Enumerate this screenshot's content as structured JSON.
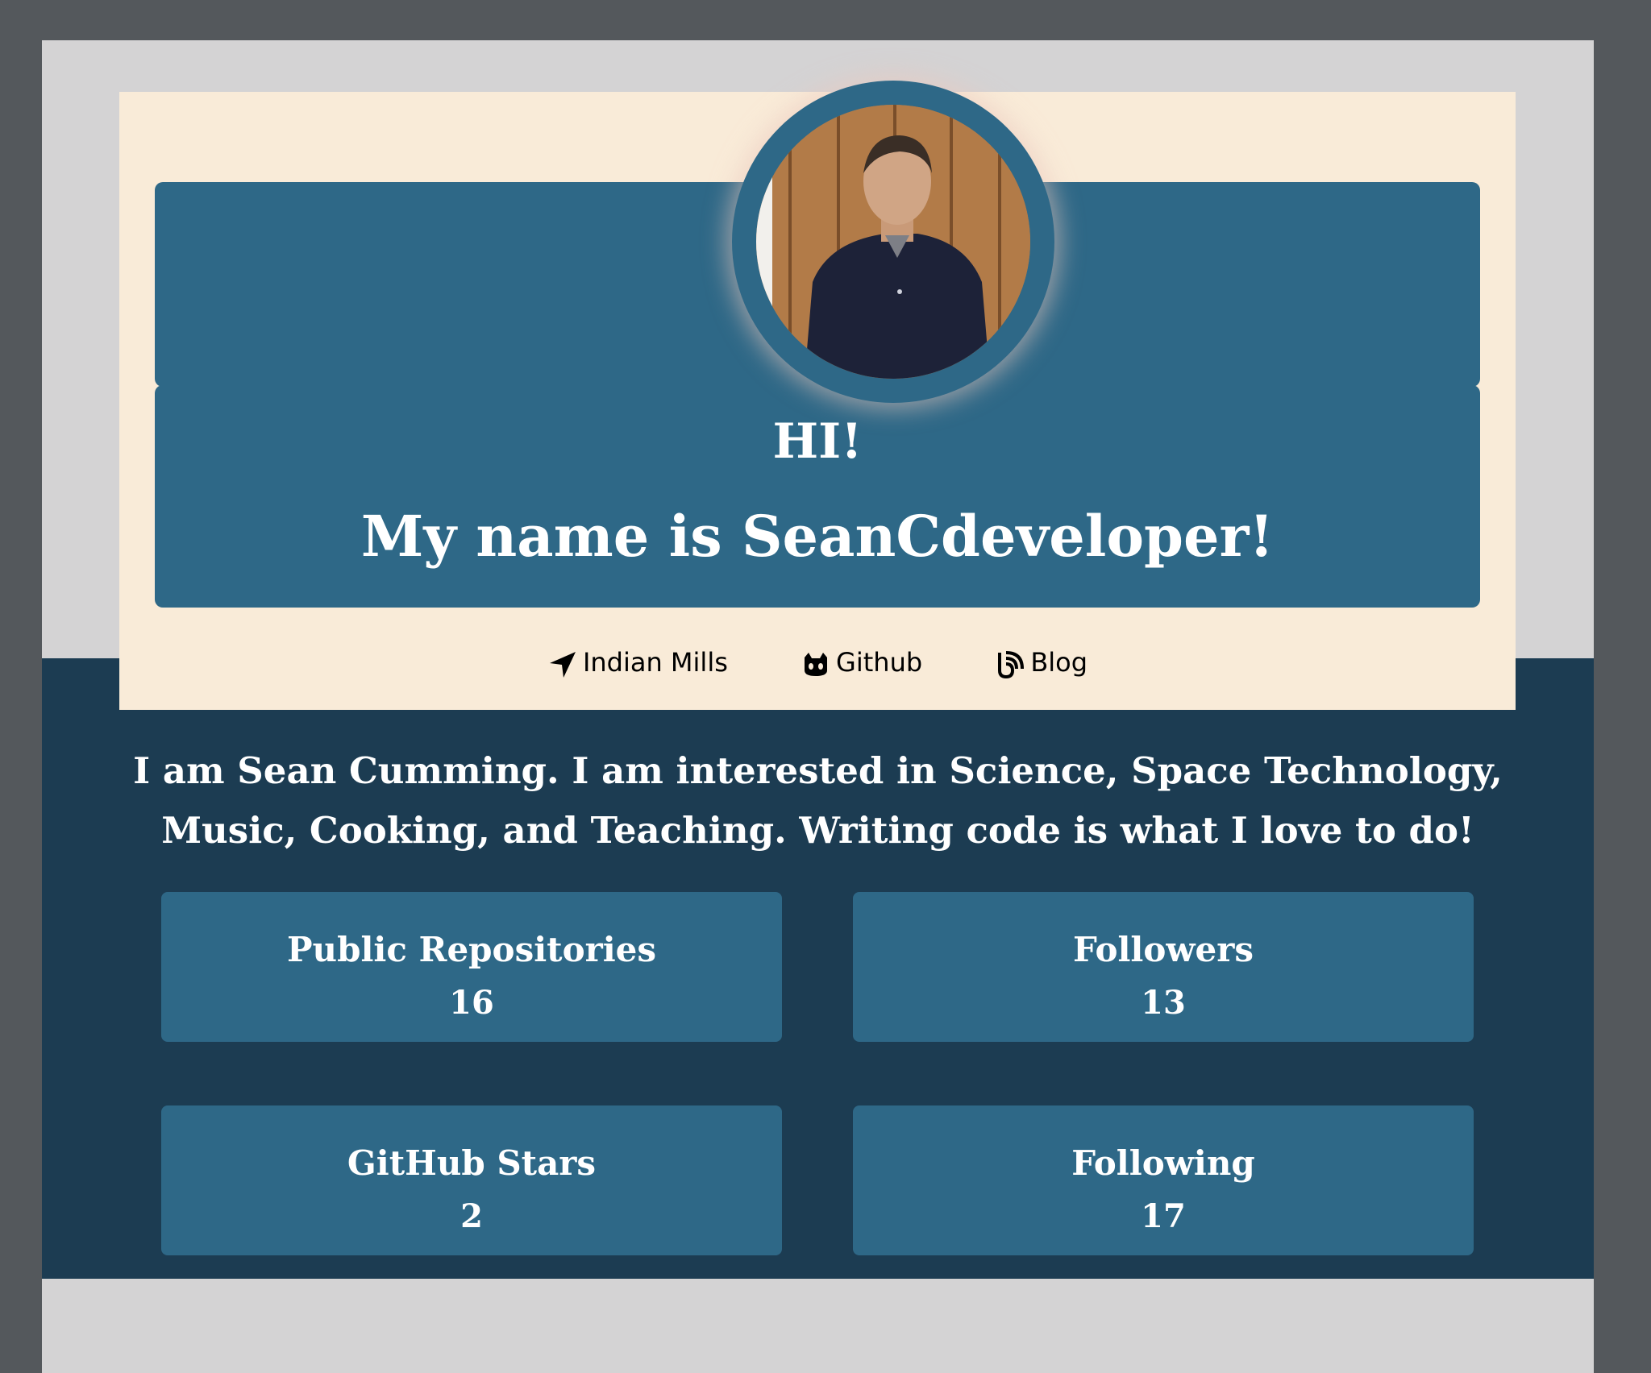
{
  "hero": {
    "greeting": "HI!",
    "name_line": "My name is SeanCdeveloper!"
  },
  "links": [
    {
      "label": "Indian Mills",
      "icon": "location-arrow-icon"
    },
    {
      "label": "Github",
      "icon": "github-icon"
    },
    {
      "label": "Blog",
      "icon": "rss-icon"
    }
  ],
  "bio": "I am Sean Cumming. I am interested in Science, Space Technology, Music, Cooking, and Teaching. Writing code is what I love to do!",
  "stats": [
    {
      "label": "Public Repositories",
      "value": "16"
    },
    {
      "label": "Followers",
      "value": "13"
    },
    {
      "label": "GitHub Stars",
      "value": "2"
    },
    {
      "label": "Following",
      "value": "17"
    }
  ],
  "colors": {
    "background": "#54585c",
    "page": "#d4d3d4",
    "card": "#f9ebd8",
    "accent": "#2e6887",
    "dark_band": "#1c3c52"
  }
}
